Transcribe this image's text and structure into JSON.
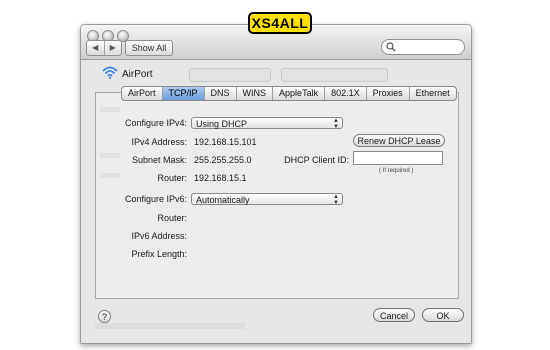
{
  "window": {
    "title_bar": {
      "back_glyph": "◀",
      "forward_glyph": "▶",
      "show_all_label": "Show All",
      "search_icon": "magnifier-icon"
    }
  },
  "badge": {
    "text": "XS4ALL",
    "color": "#ffe000"
  },
  "interface": {
    "icon": "wifi-icon",
    "label": "AirPort"
  },
  "tabs": [
    {
      "label": "AirPort",
      "active": false
    },
    {
      "label": "TCP/IP",
      "active": true
    },
    {
      "label": "DNS",
      "active": false
    },
    {
      "label": "WINS",
      "active": false
    },
    {
      "label": "AppleTalk",
      "active": false
    },
    {
      "label": "802.1X",
      "active": false
    },
    {
      "label": "Proxies",
      "active": false
    },
    {
      "label": "Ethernet",
      "active": false
    }
  ],
  "ipv4": {
    "configure_label": "Configure IPv4:",
    "configure_value": "Using DHCP",
    "address_label": "IPv4 Address:",
    "address_value": "192.168.15.101",
    "subnet_label": "Subnet Mask:",
    "subnet_value": "255.255.255.0",
    "router_label": "Router:",
    "router_value": "192.168.15.1",
    "renew_label": "Renew DHCP Lease",
    "client_id_label": "DHCP Client ID:",
    "client_id_value": "",
    "client_id_hint": "( If required )"
  },
  "ipv6": {
    "configure_label": "Configure IPv6:",
    "configure_value": "Automatically",
    "router_label": "Router:",
    "address_label": "IPv6 Address:",
    "prefix_label": "Prefix Length:"
  },
  "footer": {
    "help_label": "?",
    "cancel_label": "Cancel",
    "ok_label": "OK"
  },
  "colors": {
    "active_tab": "#6c9fdc",
    "wifi": "#3b86e0"
  }
}
